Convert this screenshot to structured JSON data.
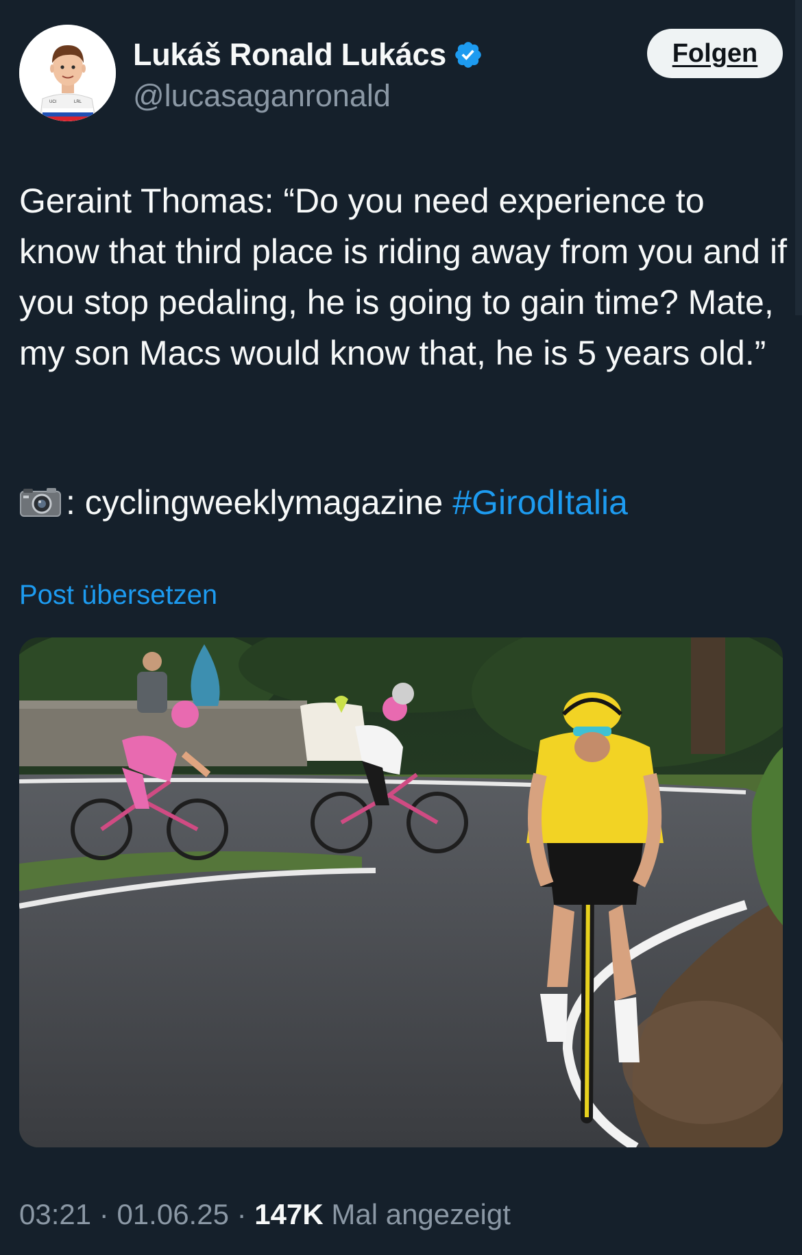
{
  "author": {
    "name": "Lukáš Ronald Lukács",
    "handle": "@lucasaganronald",
    "verified_icon": "verified-badge-icon",
    "badge_color": "#1d9bf0"
  },
  "follow_button": {
    "label": "Folgen"
  },
  "tweet": {
    "text": "Geraint Thomas: “Do you need experience to know that third place is riding away from you and if you stop pedaling, he is going to gain time? Mate, my son Macs would know that, he is 5 years old.”",
    "credit_icon": "camera-icon",
    "credit_text": ": cyclingweeklymagazine",
    "hashtag": "#GirodItalia"
  },
  "translate_link": "Post übersetzen",
  "media": {
    "type": "photo"
  },
  "meta": {
    "time": "03:21",
    "separator": "·",
    "date": "01.06.25",
    "views_count": "147K",
    "views_label": "Mal angezeigt"
  },
  "colors": {
    "background": "#15202b",
    "link": "#1d9bf0",
    "secondary_text": "#8b98a5"
  }
}
